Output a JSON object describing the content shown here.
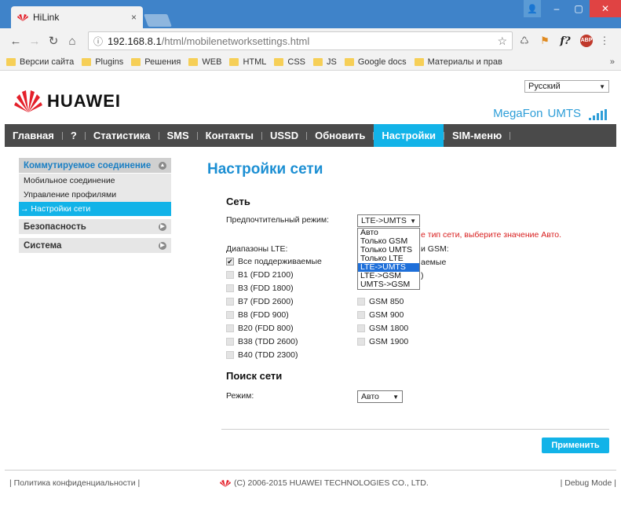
{
  "browser": {
    "tab_title": "HiLink",
    "tab_close": "×",
    "url_host": "192.168.8.1",
    "url_path": "/html/mobilenetworksettings.html",
    "bookmarks": [
      "Версии сайта",
      "Plugins",
      "Решения",
      "WEB",
      "HTML",
      "CSS",
      "JS",
      "Google docs",
      "Материалы и прав"
    ],
    "bookmarks_more": "»"
  },
  "header": {
    "language": "Русский",
    "brand": "HUAWEI",
    "operator": "MegaFon",
    "network_type": "UMTS"
  },
  "nav": {
    "items": [
      "Главная",
      "?",
      "Статистика",
      "SMS",
      "Контакты",
      "USSD",
      "Обновить",
      "Настройки",
      "SIM-меню"
    ],
    "active": "Настройки"
  },
  "sidebar": {
    "dialup": "Коммутируемое соединение",
    "sub_items": [
      "Мобильное соединение",
      "Управление профилями",
      "→ Настройки сети"
    ],
    "security": "Безопасность",
    "system": "Система"
  },
  "content": {
    "title": "Настройки сети",
    "network_section": "Сеть",
    "preferred_mode_label": "Предпочтительный режим:",
    "preferred_mode_value": "LTE->UMTS",
    "mode_options": [
      "Авто",
      "Только GSM",
      "Только UMTS",
      "Только LTE",
      "LTE->UMTS",
      "LTE->GSM",
      "UMTS->GSM"
    ],
    "selected_option": "LTE->UMTS",
    "warning_text": "е тип сети, выберите значение Авто.",
    "lte_bands_label": "Диапазоны LTE:",
    "gsm_label_tail": "и GSM:",
    "lte_bands": [
      "Все поддерживаемые",
      "B1 (FDD 2100)",
      "B3 (FDD 1800)",
      "B7 (FDD 2600)",
      "B8 (FDD 900)",
      "B20 (FDD 800)",
      "B38 (TDD 2600)",
      "B40 (TDD 2300)"
    ],
    "lte_all_checked": true,
    "gsm_all_tail": "аемые",
    "gsm_tail_2": ")",
    "gsm_bands": [
      "GSM 850",
      "GSM 900",
      "GSM 1800",
      "GSM 1900"
    ],
    "search_section": "Поиск сети",
    "search_mode_label": "Режим:",
    "search_mode_value": "Авто",
    "apply_button": "Применить"
  },
  "footer": {
    "privacy": "Политика конфиденциальности",
    "copyright": "(C) 2006-2015 HUAWEI TECHNOLOGIES CO., LTD.",
    "debug": "Debug Mode"
  },
  "colors": {
    "accent": "#12b3e8",
    "title_blue": "#1c8fd3",
    "nav_bg": "#4a4a4a",
    "warning": "#d81e1e",
    "huawei_red": "#e4202a"
  }
}
